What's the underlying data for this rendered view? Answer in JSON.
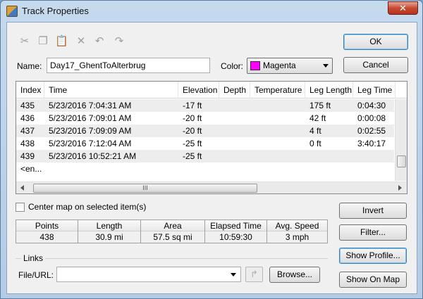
{
  "window": {
    "title": "Track Properties",
    "close_label": "✕"
  },
  "toolbar": {
    "cut": "✂",
    "copy": "❐",
    "paste": "📋",
    "delete": "✕",
    "undo": "↶",
    "redo": "↷"
  },
  "buttons": {
    "ok": "OK",
    "cancel": "Cancel",
    "invert": "Invert",
    "filter": "Filter...",
    "show_profile": "Show Profile...",
    "show_on_map": "Show On Map",
    "browse": "Browse..."
  },
  "name_field": {
    "label": "Name:",
    "value": "Day17_GhentToAlterbrug"
  },
  "color_field": {
    "label": "Color:",
    "value": "Magenta",
    "swatch": "#ff00ff"
  },
  "table": {
    "columns": [
      "Index",
      "Time",
      "Elevation",
      "Depth",
      "Temperature",
      "Leg Length",
      "Leg Time"
    ],
    "rows": [
      [
        "435",
        "5/23/2016 7:04:31 AM",
        "-17 ft",
        "",
        "",
        "175 ft",
        "0:04:30"
      ],
      [
        "436",
        "5/23/2016 7:09:01 AM",
        "-20 ft",
        "",
        "",
        "42 ft",
        "0:00:08"
      ],
      [
        "437",
        "5/23/2016 7:09:09 AM",
        "-20 ft",
        "",
        "",
        "4 ft",
        "0:02:55"
      ],
      [
        "438",
        "5/23/2016 7:12:04 AM",
        "-25 ft",
        "",
        "",
        "0 ft",
        "3:40:17"
      ],
      [
        "439",
        "5/23/2016 10:52:21 AM",
        "-25 ft",
        "",
        "",
        "",
        ""
      ]
    ],
    "end_row": "<en...",
    "hscroll_grip": "III"
  },
  "center_map": {
    "label": "Center map on selected item(s)"
  },
  "stats": {
    "headers": [
      "Points",
      "Length",
      "Area",
      "Elapsed Time",
      "Avg. Speed"
    ],
    "values": [
      "438",
      "30.9 mi",
      "57.5 sq mi",
      "10:59:30",
      "3 mph"
    ]
  },
  "links": {
    "group_title": "Links",
    "label": "File/URL:",
    "value": ""
  }
}
